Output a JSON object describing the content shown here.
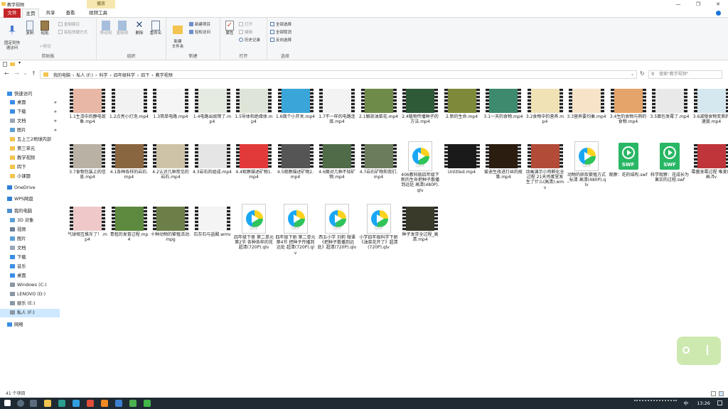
{
  "window": {
    "title": "教学视频",
    "context_tab": "播放",
    "buttons": [
      "—",
      "❐",
      "✕"
    ]
  },
  "tabs": [
    {
      "label": "文件"
    },
    {
      "label": "主页"
    },
    {
      "label": "共享"
    },
    {
      "label": "查看"
    },
    {
      "label": "视频工具"
    }
  ],
  "ribbon": {
    "clipboard": {
      "title": "剪贴板",
      "pin": "固定到快\n速访问",
      "copy": "复制",
      "paste": "粘贴",
      "copy_path": "复制路径",
      "paste_shortcut": "粘贴快捷方式",
      "cut": "剪切"
    },
    "organize": {
      "title": "组织",
      "move_to": "移动到",
      "copy_to": "复制到",
      "delete": "删除",
      "rename": "重命名"
    },
    "new": {
      "title": "新建",
      "new_folder": "新建\n文件夹",
      "new_item": "新建项目",
      "easy_access": "轻松访问"
    },
    "open": {
      "title": "打开",
      "properties": "属性",
      "open": "打开",
      "edit": "编辑",
      "history": "历史记录"
    },
    "select": {
      "title": "选择",
      "select_all": "全部选择",
      "select_none": "全部取消",
      "invert": "反向选择"
    }
  },
  "address": {
    "crumbs": [
      "我的电脑",
      "私人 (F:)",
      "科学",
      "四年级科学",
      "四下",
      "教学视频"
    ],
    "search_placeholder": "搜索\"教学视频\""
  },
  "nav": [
    {
      "label": "快速访问",
      "icon": "star-icon",
      "pin": false,
      "indent": 0
    },
    {
      "label": "桌面",
      "icon": "desktop-icon",
      "pin": true,
      "indent": 1
    },
    {
      "label": "下载",
      "icon": "download-icon",
      "pin": true,
      "indent": 1
    },
    {
      "label": "文档",
      "icon": "document-icon",
      "pin": true,
      "indent": 1
    },
    {
      "label": "图片",
      "icon": "picture-icon",
      "pin": true,
      "indent": 1
    },
    {
      "label": "五上三2地球内部",
      "icon": "folder-icon",
      "pin": false,
      "indent": 1
    },
    {
      "label": "第三单元",
      "icon": "folder-icon",
      "pin": false,
      "indent": 1
    },
    {
      "label": "教学视频",
      "icon": "folder-icon",
      "pin": false,
      "indent": 1
    },
    {
      "label": "四下",
      "icon": "folder-icon",
      "pin": false,
      "indent": 1
    },
    {
      "label": "小课题",
      "icon": "folder-icon",
      "pin": false,
      "indent": 1
    },
    {
      "label": "OneDrive",
      "icon": "cloud-icon",
      "pin": false,
      "indent": 0
    },
    {
      "label": "WPS网盘",
      "icon": "cloud-icon",
      "pin": false,
      "indent": 0
    },
    {
      "label": "我的电脑",
      "icon": "computer-icon",
      "pin": false,
      "indent": 0
    },
    {
      "label": "3D 对象",
      "icon": "cube-icon",
      "pin": false,
      "indent": 1
    },
    {
      "label": "视频",
      "icon": "video-icon",
      "pin": false,
      "indent": 1
    },
    {
      "label": "图片",
      "icon": "picture-icon",
      "pin": false,
      "indent": 1
    },
    {
      "label": "文档",
      "icon": "document-icon",
      "pin": false,
      "indent": 1
    },
    {
      "label": "下载",
      "icon": "download-icon",
      "pin": false,
      "indent": 1
    },
    {
      "label": "音乐",
      "icon": "music-icon",
      "pin": false,
      "indent": 1
    },
    {
      "label": "桌面",
      "icon": "desktop-icon",
      "pin": false,
      "indent": 1
    },
    {
      "label": "Windows (C:)",
      "icon": "drive-icon",
      "pin": false,
      "indent": 1
    },
    {
      "label": "LENOVO (D:)",
      "icon": "drive-icon",
      "pin": false,
      "indent": 1
    },
    {
      "label": "娱乐 (E:)",
      "icon": "drive-icon",
      "pin": false,
      "indent": 1
    },
    {
      "label": "私人 (F:)",
      "icon": "drive-icon",
      "pin": false,
      "indent": 1,
      "selected": true
    },
    {
      "label": "网络",
      "icon": "network-icon",
      "pin": false,
      "indent": 0
    }
  ],
  "files": [
    {
      "name": "1.1生活中的静电现象.mp4",
      "kind": "video",
      "color": "#e8b7a6"
    },
    {
      "name": "1.2点亮小灯泡.mp4",
      "kind": "video",
      "color": "#f2f2f2"
    },
    {
      "name": "1.3简单电路.mp4",
      "kind": "video",
      "color": "#f5f5f5"
    },
    {
      "name": "1.4电路出故障了.mp4",
      "kind": "video",
      "color": "#e6ebe1"
    },
    {
      "name": "1.5导体和绝缘体.mp4",
      "kind": "video",
      "color": "#dfe4d8"
    },
    {
      "name": "1.6做个小开关.mp4",
      "kind": "video",
      "color": "#3aa5d8"
    },
    {
      "name": "1.7不一样的电路连接.mp4",
      "kind": "video",
      "color": "#f3f3f3"
    },
    {
      "name": "2.1解剖油菜花.mp4",
      "kind": "video",
      "color": "#6f8b4a"
    },
    {
      "name": "2.4植物传播种子的方法.mp4",
      "kind": "video",
      "color": "#2f5a37"
    },
    {
      "name": "2.新的生命.mp4",
      "kind": "video",
      "color": "#7e8a3a"
    },
    {
      "name": "3.1一天的食物.mp4",
      "kind": "video",
      "color": "#3d8a6e"
    },
    {
      "name": "3.2食物中的营养.mp4",
      "kind": "video",
      "color": "#f0e2b5"
    },
    {
      "name": "3.3营养要均衡.mp4",
      "kind": "video",
      "color": "#f6e3c8"
    },
    {
      "name": "3.4生的食物与熟的食物.mp4",
      "kind": "video",
      "color": "#e4a46a"
    },
    {
      "name": "3.5面包发霉了.mp4",
      "kind": "video",
      "color": "#e9e9e9"
    },
    {
      "name": "3.6减慢食物变质的速度.mp4",
      "kind": "video",
      "color": "#d6e8ef"
    },
    {
      "name": "3.7食物包装上的信息.mp4",
      "kind": "video",
      "color": "#b9b2a4"
    },
    {
      "name": "4.1各种各样的岩石.mp4",
      "kind": "video",
      "color": "#8a6640"
    },
    {
      "name": "4.2认识几种常见的岩石.mp4",
      "kind": "video",
      "color": "#cfc3a7"
    },
    {
      "name": "4.3岩石的组成.mp4",
      "kind": "video",
      "color": "#e5e5e5"
    },
    {
      "name": "4.4观察描述矿物1.mp4",
      "kind": "video",
      "color": "#e23a3a"
    },
    {
      "name": "4.5观察描述矿物2.mp4",
      "kind": "video",
      "color": "#555555"
    },
    {
      "name": "4.6面对几种不知矿物.mp4",
      "kind": "video",
      "color": "#4f6b48"
    },
    {
      "name": "4.7岩石矿物和我们.mp4",
      "kind": "video",
      "color": "#6b7c5b"
    },
    {
      "name": "406教科版四年级下新的生命把种子散播到远处 高清(480P).qlv",
      "kind": "qlv"
    },
    {
      "name": "Untitled.mp4",
      "kind": "video",
      "color": "#1a1a1a"
    },
    {
      "name": "爱迪生改进灯丝的故事.mp4",
      "kind": "video",
      "color": "#2b1d10"
    },
    {
      "name": "动画演示小鸡孵化全过程 21天鸡蛋里发生了什么(高清).wmv",
      "kind": "video",
      "color": "#b24b38"
    },
    {
      "name": "动物的卵及繁殖方式_标清 高清(480P).qlv",
      "kind": "qlv"
    },
    {
      "name": "观察：花的结构.swf",
      "kind": "swf"
    },
    {
      "name": "科学观察：花成长为果实的过程.swf",
      "kind": "swf"
    },
    {
      "name": "霉菌发霉过程 唯美如画.flv",
      "kind": "video",
      "color": "#c0353a"
    },
    {
      "name": "气球相互推斥了！.mp4",
      "kind": "video",
      "color": "#efc9c9"
    },
    {
      "name": "青蛙的发育过程.mp4",
      "kind": "video",
      "color": "#5d8a3f"
    },
    {
      "name": "十种动物的繁殖活动.mpg",
      "kind": "video",
      "color": "#6d7f49"
    },
    {
      "name": "石灰石与盐酸.wmv",
      "kind": "video",
      "color": "#f4f4f4"
    },
    {
      "name": "四年级下册 第二单元第2节 各种各样的花 超清(720P).qlv",
      "kind": "qlv"
    },
    {
      "name": "四年级下册 第二单元第4节 把种子传播到远处 超清(720P).qlv",
      "kind": "qlv"
    },
    {
      "name": "西五小学 刘莉 微课《把种子散播到远处》超清(720P).qlv",
      "kind": "qlv"
    },
    {
      "name": "小学四年级科学下册《油菜花开了》超清(720P).qlv",
      "kind": "qlv"
    },
    {
      "name": "种子发芽全过程_高清.mp4",
      "kind": "video",
      "color": "#3a3a2a"
    }
  ],
  "file_badges": {
    "qlv": "QLV",
    "swf": "SWF"
  },
  "status": {
    "count": "41 个项目"
  },
  "taskbar": {
    "clock": "13:26",
    "ime": "中"
  },
  "colors": {
    "accent": "#c4262a",
    "selection": "#cde8ff"
  }
}
